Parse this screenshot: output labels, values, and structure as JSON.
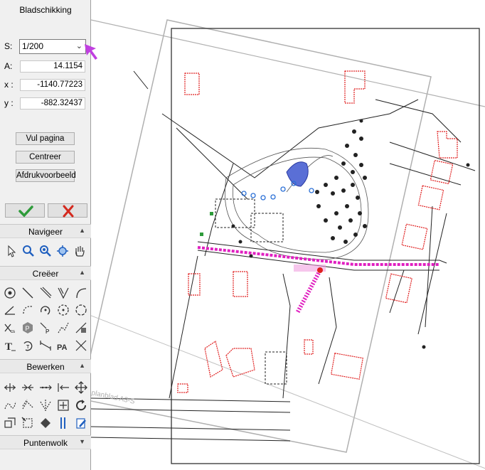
{
  "panel": {
    "title": "Bladschikking",
    "scale_label": "S:",
    "scale_value": "1/200",
    "a_label": "A:",
    "a_value": "14.1154",
    "x_label": "x :",
    "x_value": "-1140.77223",
    "y_label": "y :",
    "y_value": "-882.32437",
    "fill_page_label": "Vul pagina",
    "center_label": "Centreer",
    "preview_label": "Afdrukvoorbeeld"
  },
  "sections": {
    "navigate": "Navigeer",
    "create": "Creëer",
    "edit": "Bewerken",
    "pointcloud": "Puntenwolk"
  },
  "map": {
    "sheet_label": "planblad A3-S"
  },
  "colors": {
    "ok_green": "#2e9b3a",
    "cancel_red": "#d42a1f",
    "pointer_magenta": "#c040e0",
    "building_red": "#e02020",
    "water_blue": "#5a6fd6",
    "road_magenta": "#e020c0",
    "frame_gray": "#b0b0b0"
  },
  "icons": {
    "navigate": [
      "pointer-icon",
      "zoom-in-icon",
      "zoom-out-icon",
      "zoom-extents-icon",
      "pan-hand-icon"
    ],
    "create": [
      "circle-icon",
      "line-icon",
      "double-line-icon",
      "angle-lines-icon",
      "arc-icon",
      "angle-icon",
      "dashed-arc-icon",
      "circle-point-icon",
      "dashed-circle-icon",
      "circle-center-icon",
      "point-x-icon",
      "point-p-icon",
      "point-p2-icon",
      "polyline-icon",
      "grid-point-icon",
      "text-icon",
      "rotate-text-icon",
      "dimension-icon",
      "pa-text-icon",
      "cross-lines-icon"
    ],
    "edit": [
      "extend-icon",
      "stretch-icon",
      "divide-icon",
      "trim-icon",
      "move-icon",
      "curve-icon",
      "offset-icon",
      "mirror-icon",
      "grid-add-icon",
      "rotate-icon",
      "copy-icon",
      "align-icon",
      "fill-icon",
      "parallel-icon",
      "edit-page-icon"
    ]
  }
}
